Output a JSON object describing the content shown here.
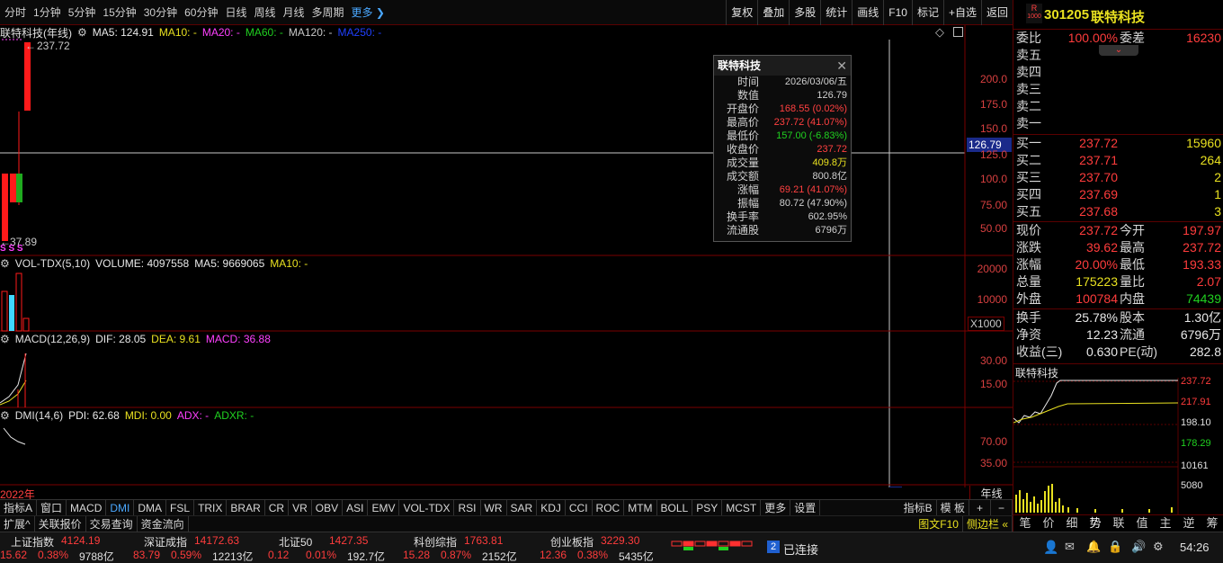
{
  "toolbar": {
    "periods": [
      "分时",
      "1分钟",
      "5分钟",
      "15分钟",
      "30分钟",
      "60分钟",
      "日线",
      "周线",
      "月线",
      "多周期",
      "更多"
    ],
    "tools": [
      "复权",
      "叠加",
      "多股",
      "统计",
      "画线",
      "F10",
      "标记",
      "+自选",
      "返回"
    ]
  },
  "main_chart": {
    "title": "联特科技(年线)",
    "ma5": "MA5: 124.91",
    "ma10": "MA10: -",
    "ma20": "MA20: -",
    "ma60": "MA60: -",
    "ma120": "MA120: -",
    "ma250": "MA250: -",
    "high_label": "237.72",
    "low_label": "37.89",
    "crosshair_value": "126.79",
    "yticks": [
      "200.0",
      "175.0",
      "150.0",
      "125.0",
      "100.0",
      "75.00",
      "50.00"
    ],
    "year_label": "2022年",
    "s_marks": "S S S"
  },
  "volume_panel": {
    "legend": "VOL-TDX(5,10)",
    "volume": "VOLUME: 4097558",
    "ma5": "MA5: 9669065",
    "ma10": "MA10: -",
    "yticks": [
      "20000",
      "10000"
    ],
    "unit": "X1000"
  },
  "macd_panel": {
    "legend": "MACD(12,26,9)",
    "dif": "DIF: 28.05",
    "dea": "DEA: 9.61",
    "macd": "MACD: 36.88",
    "yticks": [
      "30.00",
      "15.00"
    ]
  },
  "dmi_panel": {
    "legend": "DMI(14,6)",
    "pdi": "PDI: 62.68",
    "mdi": "MDI: 0.00",
    "adx": "ADX: -",
    "adxr": "ADXR: -",
    "yticks": [
      "70.00",
      "35.00"
    ]
  },
  "tooltip": {
    "title": "联特科技",
    "rows": [
      {
        "k": "时间",
        "v": "2026/03/06/五",
        "c": "#d0d0d0"
      },
      {
        "k": "数值",
        "v": "126.79",
        "c": "#d0d0d0"
      },
      {
        "k": "开盘价",
        "v": "168.55 (0.02%)",
        "c": "#ff4040"
      },
      {
        "k": "最高价",
        "v": "237.72 (41.07%)",
        "c": "#ff4040"
      },
      {
        "k": "最低价",
        "v": "157.00 (-6.83%)",
        "c": "#20d020"
      },
      {
        "k": "收盘价",
        "v": "237.72",
        "c": "#ff4040"
      },
      {
        "k": "成交量",
        "v": "409.8万",
        "c": "#e8e020"
      },
      {
        "k": "成交额",
        "v": "800.8亿",
        "c": "#d0d0d0"
      },
      {
        "k": "涨幅",
        "v": "69.21 (41.07%)",
        "c": "#ff4040"
      },
      {
        "k": "振幅",
        "v": "80.72 (47.90%)",
        "c": "#d0d0d0"
      },
      {
        "k": "换手率",
        "v": "602.95%",
        "c": "#d0d0d0"
      },
      {
        "k": "流通股",
        "v": "6796万",
        "c": "#d0d0d0"
      }
    ]
  },
  "indicator_tabs": [
    "指标A",
    "窗口",
    "MACD",
    "DMI",
    "DMA",
    "FSL",
    "TRIX",
    "BRAR",
    "CR",
    "VR",
    "OBV",
    "ASI",
    "EMV",
    "VOL-TDX",
    "RSI",
    "WR",
    "SAR",
    "KDJ",
    "CCI",
    "ROC",
    "MTM",
    "BOLL",
    "PSY",
    "MCST",
    "更多",
    "设置"
  ],
  "indicator_tabs_right": [
    "指标B",
    "模 板"
  ],
  "period_label": "年线",
  "aux_tabs": [
    "扩展^",
    "关联报价",
    "交易查询",
    "资金流向"
  ],
  "aux_right": [
    "图文F10",
    "侧边栏 «"
  ],
  "quote": {
    "code": "301205",
    "name": "联特科技",
    "badge": "R",
    "badge_sub": "1000",
    "weibi_label": "委比",
    "weibi": "100.00%",
    "weicha_label": "委差",
    "weicha": "16230",
    "sell_labels": [
      "卖五",
      "卖四",
      "卖三",
      "卖二",
      "卖一"
    ],
    "buy": [
      {
        "label": "买一",
        "price": "237.72",
        "vol": "15960"
      },
      {
        "label": "买二",
        "price": "237.71",
        "vol": "264"
      },
      {
        "label": "买三",
        "price": "237.70",
        "vol": "2"
      },
      {
        "label": "买四",
        "price": "237.69",
        "vol": "1"
      },
      {
        "label": "买五",
        "price": "237.68",
        "vol": "3"
      }
    ],
    "stats": [
      {
        "l1": "现价",
        "v1": "237.72",
        "c1": "#ff3c3c",
        "l2": "今开",
        "v2": "197.97",
        "c2": "#ff3c3c"
      },
      {
        "l1": "涨跌",
        "v1": "39.62",
        "c1": "#ff3c3c",
        "l2": "最高",
        "v2": "237.72",
        "c2": "#ff3c3c"
      },
      {
        "l1": "涨幅",
        "v1": "20.00%",
        "c1": "#ff3c3c",
        "l2": "最低",
        "v2": "193.33",
        "c2": "#ff3c3c"
      },
      {
        "l1": "总量",
        "v1": "175223",
        "c1": "#e8e020",
        "l2": "量比",
        "v2": "2.07",
        "c2": "#ff3c3c"
      },
      {
        "l1": "外盘",
        "v1": "100784",
        "c1": "#ff3c3c",
        "l2": "内盘",
        "v2": "74439",
        "c2": "#20d020"
      }
    ],
    "stats2": [
      {
        "l1": "换手",
        "v1": "25.78%",
        "l2": "股本",
        "v2": "1.30亿"
      },
      {
        "l1": "净资",
        "v1": "12.23",
        "l2": "流通",
        "v2": "6796万"
      },
      {
        "l1": "收益(三)",
        "v1": "0.630",
        "l2": "PE(动)",
        "v2": "282.8"
      }
    ],
    "mini_title": "联特科技",
    "mini_yticks": [
      "237.72",
      "217.91",
      "198.10",
      "178.29"
    ],
    "mini_vol_ticks": [
      "10161",
      "5080"
    ],
    "side_tabs": [
      "笔",
      "价",
      "细",
      "势",
      "联",
      "值",
      "主",
      "逆",
      "筹"
    ]
  },
  "status": {
    "indices": [
      {
        "name": "上证指数",
        "val": "4124.19",
        "chg": "15.62",
        "pct": "0.38%",
        "amt": "9788亿"
      },
      {
        "name": "深证成指",
        "val": "14172.63",
        "chg": "83.79",
        "pct": "0.59%",
        "amt": "12213亿"
      },
      {
        "name": "北证50",
        "val": "1427.35",
        "chg": "0.12",
        "pct": "0.01%",
        "amt": "192.7亿"
      },
      {
        "name": "科创综指",
        "val": "1763.81",
        "chg": "15.28",
        "pct": "0.87%",
        "amt": "2152亿"
      },
      {
        "name": "创业板指",
        "val": "3229.30",
        "chg": "12.36",
        "pct": "0.38%",
        "amt": "5435亿"
      }
    ],
    "conn_count": "2",
    "conn_text": "已连接",
    "time": "54:26"
  }
}
